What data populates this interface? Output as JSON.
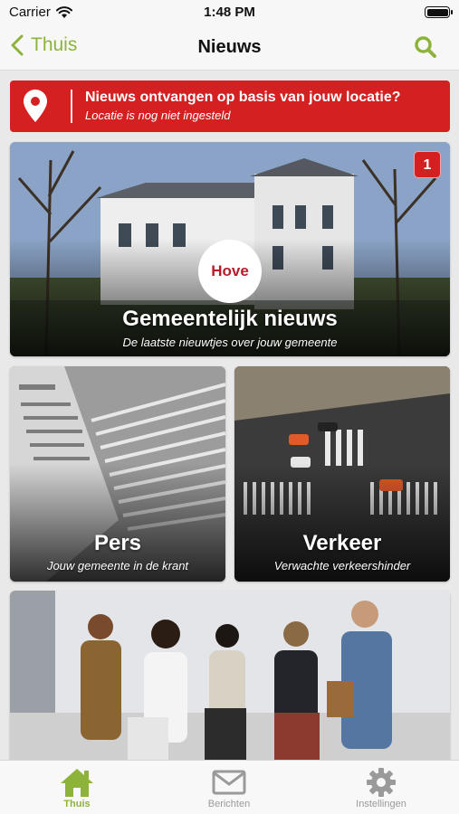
{
  "status_bar": {
    "carrier": "Carrier",
    "time": "1:48 PM"
  },
  "nav": {
    "back_label": "Thuis",
    "title": "Nieuws"
  },
  "location_banner": {
    "title": "Nieuws ontvangen op basis van jouw locatie?",
    "subtitle": "Locatie is nog niet ingesteld"
  },
  "tiles": [
    {
      "title": "Gemeentelijk nieuws",
      "subtitle": "De laatste nieuwtjes over jouw gemeente",
      "badge": "1",
      "logo_text": "Hove"
    },
    {
      "title": "Pers",
      "subtitle": "Jouw gemeente in de krant"
    },
    {
      "title": "Verkeer",
      "subtitle": "Verwachte verkeershinder"
    }
  ],
  "tabbar": [
    {
      "label": "Thuis",
      "icon": "home-icon",
      "active": true
    },
    {
      "label": "Berichten",
      "icon": "envelope-icon",
      "active": false
    },
    {
      "label": "Instellingen",
      "icon": "gear-icon",
      "active": false
    }
  ],
  "colors": {
    "accent": "#8db33b",
    "banner": "#d42020",
    "inactive": "#9a9a9a"
  }
}
